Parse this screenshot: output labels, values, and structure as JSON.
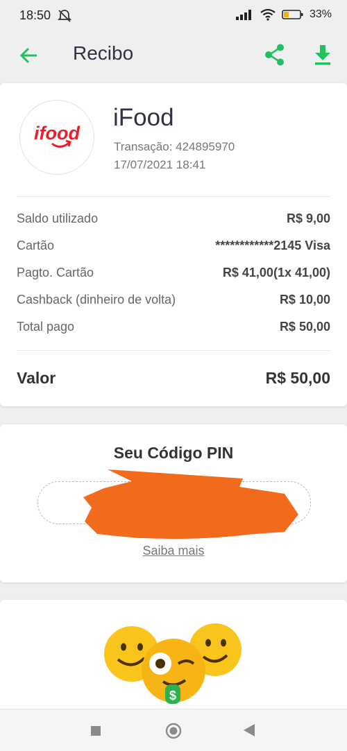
{
  "status_bar": {
    "time": "18:50",
    "battery_percent": "33%",
    "battery_level": 0.33,
    "battery_color": "#f5b400"
  },
  "app_bar": {
    "title": "Recibo",
    "back_icon": "arrow-left-icon",
    "share_icon": "share-icon",
    "download_icon": "download-icon",
    "accent_color": "#21c25e"
  },
  "receipt": {
    "logo_text": "ifood",
    "logo_color": "#ea1d2c",
    "merchant": "iFood",
    "transaction": "Transação: 424895970",
    "datetime": "17/07/2021 18:41",
    "rows": [
      {
        "label": "Saldo utilizado",
        "value": "R$ 9,00"
      },
      {
        "label": "Cartão",
        "value": "************2145 Visa"
      },
      {
        "label": "Pagto. Cartão",
        "value": "R$ 41,00(1x 41,00)"
      },
      {
        "label": "Cashback (dinheiro de volta)",
        "value": "R$ 10,00"
      },
      {
        "label": "Total pago",
        "value": "R$ 50,00"
      }
    ],
    "total_label": "Valor",
    "total_value": "R$ 50,00"
  },
  "pin": {
    "title": "Seu Código PIN",
    "link": "Saiba mais",
    "redaction_color": "#f26a1b"
  },
  "promo": {
    "illustration": "emoji-faces-illustration",
    "money_symbol": "$"
  },
  "nav_bar": {
    "recents_icon": "square-icon",
    "home_icon": "circle-icon",
    "back_icon": "triangle-back-icon"
  }
}
